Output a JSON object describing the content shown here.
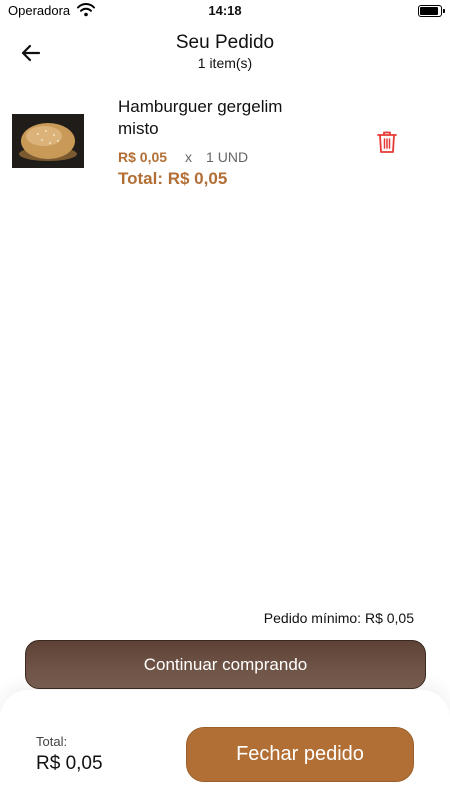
{
  "status_bar": {
    "carrier": "Operadora",
    "time": "14:18"
  },
  "header": {
    "title": "Seu Pedido",
    "subtitle": "1 item(s)"
  },
  "cart": {
    "items": [
      {
        "name": "Hamburguer gergelim misto",
        "unit_price": "R$ 0,05",
        "multiplier": "x",
        "quantity": "1 UND",
        "total": "Total: R$ 0,05"
      }
    ]
  },
  "minimum_order": "Pedido mínimo: R$ 0,05",
  "continue_button": "Continuar comprando",
  "footer": {
    "total_label": "Total:",
    "total_value": "R$ 0,05",
    "checkout_button": "Fechar pedido"
  },
  "colors": {
    "accent": "#b26f35",
    "continue_button": "#6a4f42",
    "delete_icon": "#e53935"
  }
}
